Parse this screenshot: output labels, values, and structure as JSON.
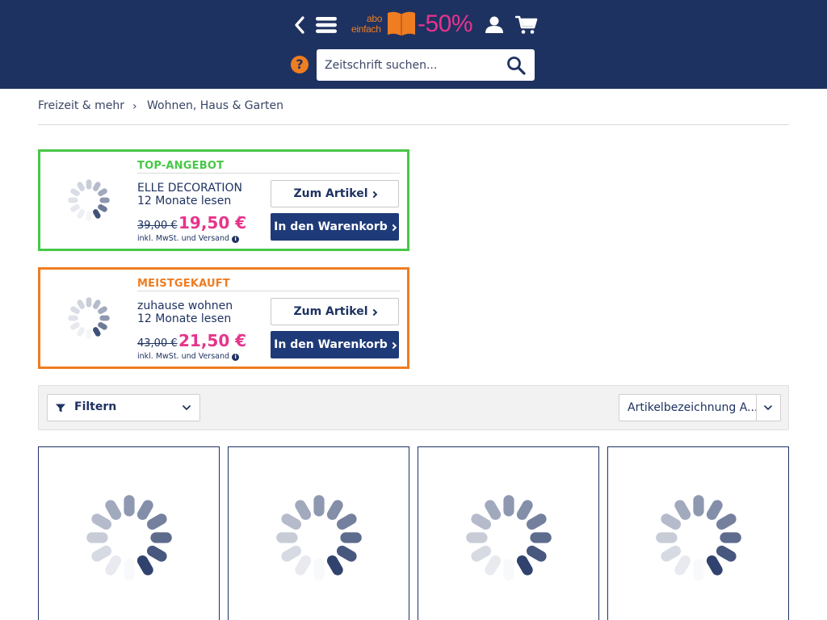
{
  "header": {
    "logo": {
      "top": "abo",
      "bottom": "einfach",
      "discount": "-50%"
    },
    "search": {
      "placeholder": "Zeitschrift suchen..."
    },
    "help_symbol": "?"
  },
  "breadcrumb": {
    "items": [
      "Freizeit & mehr",
      "Wohnen, Haus & Garten"
    ],
    "separator": "›"
  },
  "offers": [
    {
      "label": "TOP-ANGEBOT",
      "title": "ELLE DECORATION",
      "subtitle": "12 Monate lesen",
      "price_old": "39,00 €",
      "price_new": "19,50 €",
      "price_mark": "*",
      "note": "inkl. MwSt. und Versand",
      "info_symbol": "i",
      "btn_article": "Zum Artikel",
      "btn_cart": "In den Warenkorb",
      "accent": "#47c747"
    },
    {
      "label": "MEISTGEKAUFT",
      "title": "zuhause wohnen",
      "subtitle": "12 Monate lesen",
      "price_old": "43,00 €",
      "price_new": "21,50 €",
      "price_mark": "*",
      "note": "inkl. MwSt. und Versand",
      "info_symbol": "i",
      "btn_article": "Zum Artikel",
      "btn_cart": "In den Warenkorb",
      "accent": "#ef7d22"
    }
  ],
  "filter_bar": {
    "filter_label": "Filtern",
    "sort_label": "Artikelbezeichnung A..."
  },
  "icons": {
    "back": "chevron-left-icon",
    "menu": "hamburger-menu-icon",
    "user": "user-icon",
    "cart": "shopping-cart-icon",
    "help": "help-icon",
    "search": "magnifier-icon",
    "filter": "funnel-icon",
    "loading": "loading-spinner-icon"
  },
  "colors": {
    "header_bg": "#1e3261",
    "brand_orange": "#ef7d22",
    "price_pink": "#e6348c",
    "top_green": "#47c747",
    "button_blue": "#1e3a78"
  },
  "products": [
    {},
    {},
    {},
    {}
  ]
}
